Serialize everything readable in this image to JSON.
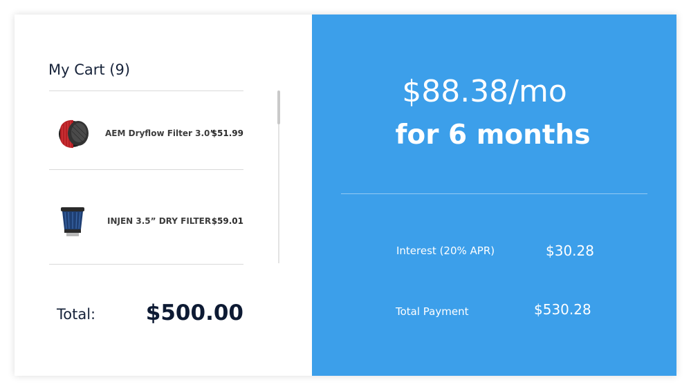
{
  "cart": {
    "title": "My Cart (9)",
    "items": [
      {
        "name": "AEM Dryflow Filter 3.0”",
        "price": "$51.99",
        "image": "red-air-filter"
      },
      {
        "name": "INJEN 3.5” DRY FILTER",
        "price": "$59.01",
        "image": "blue-air-filter"
      }
    ],
    "total_label": "Total:",
    "total_value": "$500.00"
  },
  "financing": {
    "monthly_payment": "$88.38/mo",
    "duration": "for 6 months",
    "interest_label": "Interest (20% APR)",
    "interest_value": "$30.28",
    "total_payment_label": "Total Payment",
    "total_payment_value": "$530.28"
  },
  "colors": {
    "accent": "#3c9fea",
    "text_dark": "#0d1a33",
    "divider": "#d9d9d9"
  }
}
